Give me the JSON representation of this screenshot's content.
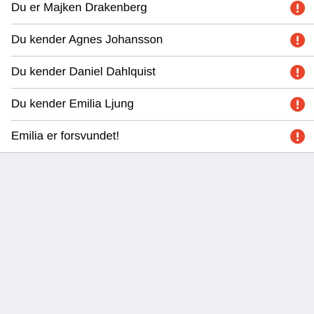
{
  "list": {
    "items": [
      {
        "label": "Du er Majken Drakenberg",
        "icon": "alert-icon"
      },
      {
        "label": "Du kender Agnes Johansson",
        "icon": "alert-icon"
      },
      {
        "label": "Du kender Daniel Dahlquist",
        "icon": "alert-icon"
      },
      {
        "label": "Du kender Emilia Ljung",
        "icon": "alert-icon"
      },
      {
        "label": "Emilia er forsvundet!",
        "icon": "alert-icon"
      }
    ]
  },
  "colors": {
    "background": "#efeff4",
    "row_background": "#ffffff",
    "separator": "#c8c7cc",
    "alert": "#e8452c",
    "text": "#000000"
  }
}
